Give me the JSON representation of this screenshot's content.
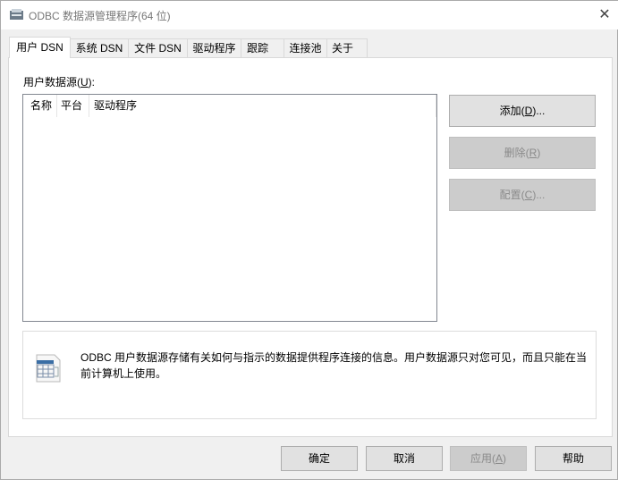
{
  "window": {
    "title": "ODBC 数据源管理程序(64 位)",
    "close_icon": "close-icon"
  },
  "tabs": [
    {
      "label": "用户 DSN",
      "selected": true
    },
    {
      "label": "系统 DSN"
    },
    {
      "label": "文件 DSN"
    },
    {
      "label": "驱动程序"
    },
    {
      "label": "跟踪"
    },
    {
      "label": "连接池"
    },
    {
      "label": "关于"
    }
  ],
  "user_dsn": {
    "label_pre": "用户数据源(",
    "label_key": "U",
    "label_post": "):",
    "columns": [
      "名称",
      "平台",
      "驱动程序"
    ],
    "rows": [],
    "buttons": {
      "add": {
        "pre": "添加(",
        "key": "D",
        "post": ")..."
      },
      "remove": {
        "pre": "删除(",
        "key": "R",
        "post": ")"
      },
      "configure": {
        "pre": "配置(",
        "key": "C",
        "post": ")..."
      }
    },
    "info": "ODBC 用户数据源存储有关如何与指示的数据提供程序连接的信息。用户数据源只对您可见，而且只能在当前计算机上使用。"
  },
  "footer": {
    "ok": "确定",
    "cancel": "取消",
    "apply": {
      "pre": "应用(",
      "key": "A",
      "post": ")"
    },
    "help": "帮助"
  }
}
